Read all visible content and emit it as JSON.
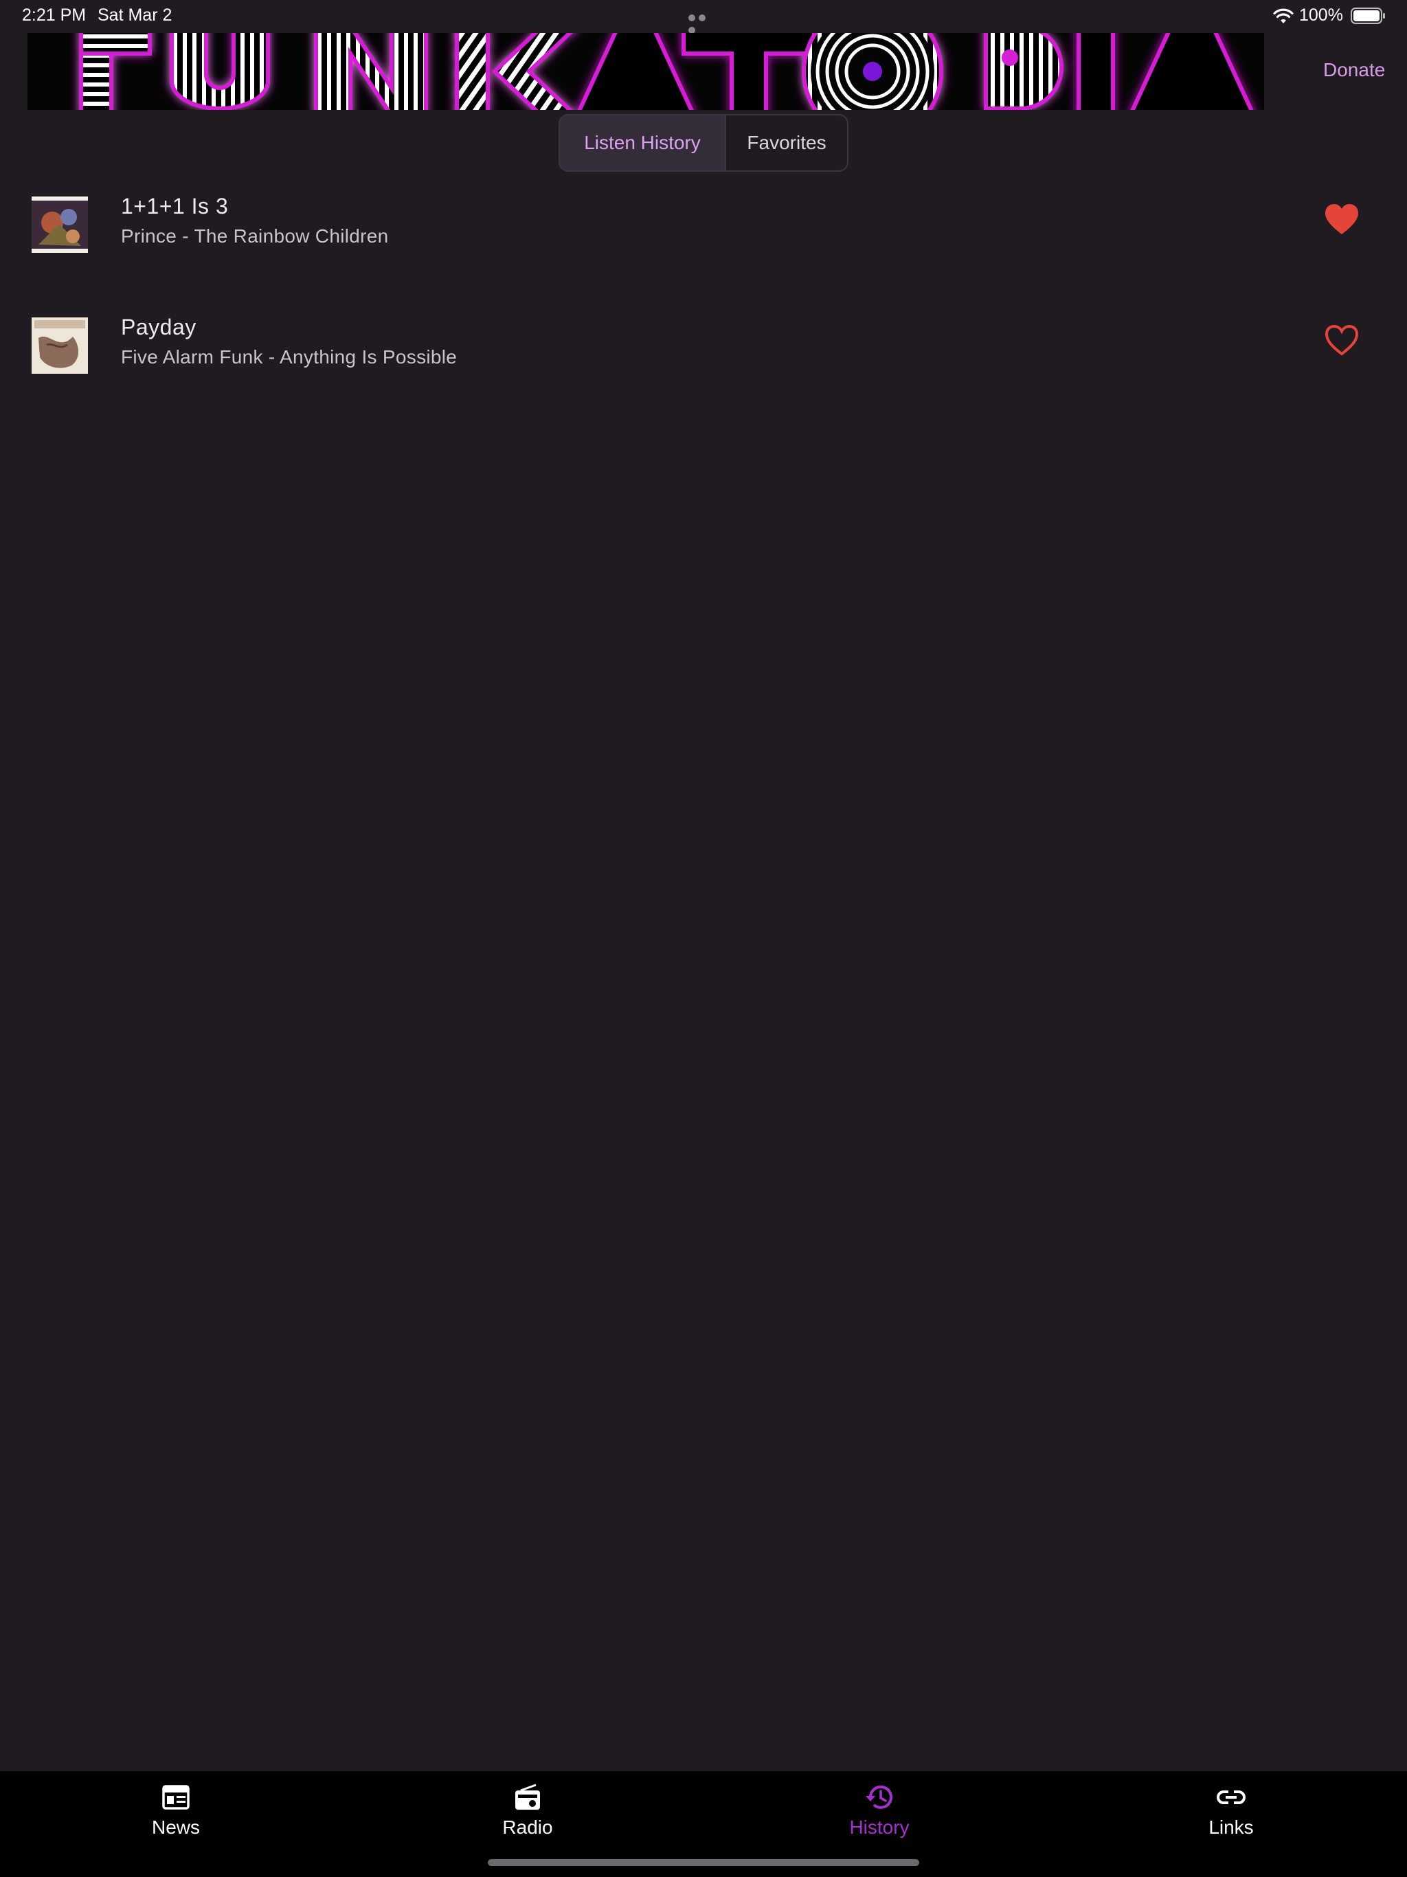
{
  "status_bar": {
    "time": "2:21 PM",
    "date": "Sat Mar 2",
    "battery": "100%"
  },
  "header": {
    "logo_text": "FUNKATOPIA",
    "donate_label": "Donate"
  },
  "segments": {
    "active": "Listen History",
    "inactive": "Favorites"
  },
  "history": [
    {
      "title": "1+1+1 Is 3",
      "subtitle": "Prince - The Rainbow Children",
      "favorited": true
    },
    {
      "title": "Payday",
      "subtitle": "Five Alarm Funk - Anything Is Possible",
      "favorited": false
    }
  ],
  "tabs": [
    {
      "label": "News",
      "icon": "newspaper-icon",
      "active": false
    },
    {
      "label": "Radio",
      "icon": "radio-icon",
      "active": false
    },
    {
      "label": "History",
      "icon": "history-icon",
      "active": true
    },
    {
      "label": "Links",
      "icon": "link-icon",
      "active": false
    }
  ],
  "colors": {
    "accent": "#a72fcf",
    "heart": "#e5443a",
    "background": "#1f1b20",
    "tabbar": "#000000"
  }
}
